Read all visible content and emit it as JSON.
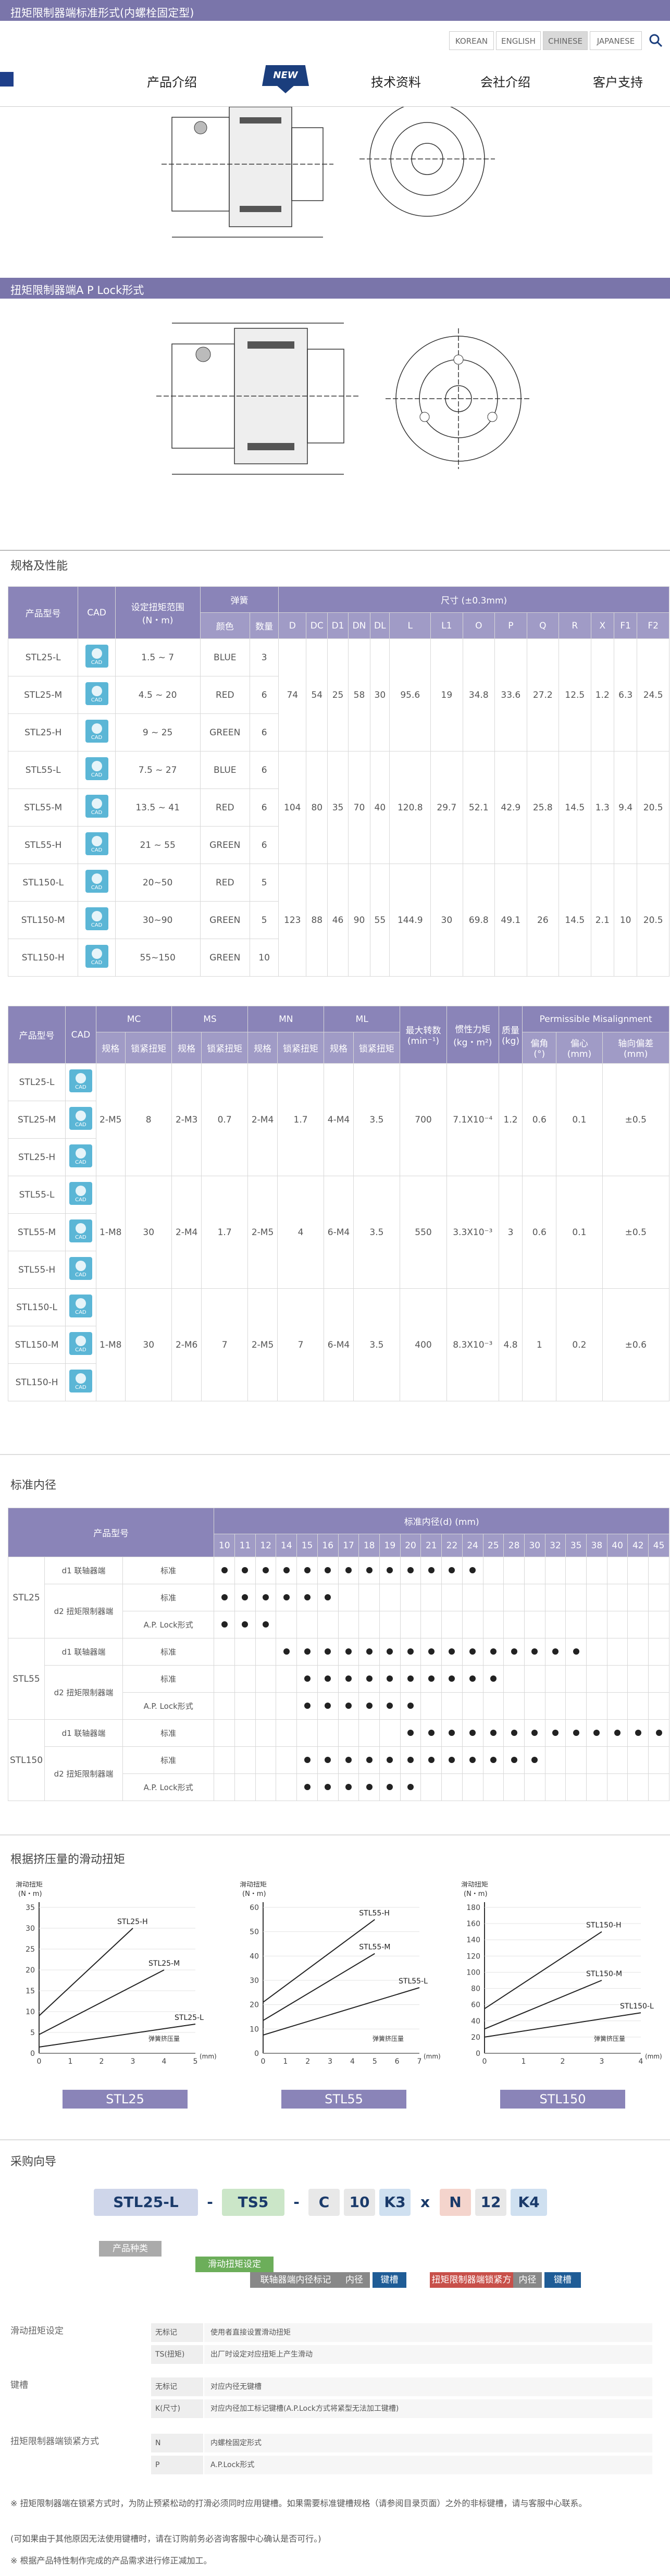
{
  "header": {
    "title": "扭矩限制器端标准形式(内螺栓固定型)",
    "languages": [
      "KOREAN",
      "ENGLISH",
      "CHINESE",
      "JAPANESE"
    ],
    "active_language": "CHINESE"
  },
  "nav": {
    "items": [
      "产品介绍",
      "技术资料",
      "会社介绍",
      "客户支持"
    ],
    "new_badge": "NEW"
  },
  "section2": {
    "title": "扭矩限制器端A P Lock形式"
  },
  "spec": {
    "title": "规格及性能",
    "t1_headers": {
      "model": "产品型号",
      "cad": "CAD",
      "torque": "设定扭矩范围",
      "torque_unit": "(N・m)",
      "spring": "弹簧",
      "color": "颜色",
      "qty": "数量",
      "dim": "尺寸 (±0.3mm)"
    },
    "t1_dim_cols": [
      "D",
      "DC",
      "D1",
      "DN",
      "DL",
      "L",
      "L1",
      "O",
      "P",
      "Q",
      "R",
      "X",
      "F1",
      "F2"
    ],
    "t1_rows": [
      {
        "model": "STL25-L",
        "torque": "1.5 ~ 7",
        "color": "BLUE",
        "qty": "3"
      },
      {
        "model": "STL25-M",
        "torque": "4.5 ~ 20",
        "color": "RED",
        "qty": "6"
      },
      {
        "model": "STL25-H",
        "torque": "9 ~ 25",
        "color": "GREEN",
        "qty": "6"
      },
      {
        "model": "STL55-L",
        "torque": "7.5 ~ 27",
        "color": "BLUE",
        "qty": "6"
      },
      {
        "model": "STL55-M",
        "torque": "13.5 ~ 41",
        "color": "RED",
        "qty": "6"
      },
      {
        "model": "STL55-H",
        "torque": "21 ~ 55",
        "color": "GREEN",
        "qty": "6"
      },
      {
        "model": "STL150-L",
        "torque": "20~50",
        "color": "RED",
        "qty": "5"
      },
      {
        "model": "STL150-M",
        "torque": "30~90",
        "color": "GREEN",
        "qty": "5"
      },
      {
        "model": "STL150-H",
        "torque": "55~150",
        "color": "GREEN",
        "qty": "10"
      }
    ],
    "t1_group_dims": [
      [
        "74",
        "54",
        "25",
        "58",
        "30",
        "95.6",
        "19",
        "34.8",
        "33.6",
        "27.2",
        "12.5",
        "1.2",
        "6.3",
        "24.5"
      ],
      [
        "104",
        "80",
        "35",
        "70",
        "40",
        "120.8",
        "29.7",
        "52.1",
        "42.9",
        "25.8",
        "14.5",
        "1.3",
        "9.4",
        "20.5"
      ],
      [
        "123",
        "88",
        "46",
        "90",
        "55",
        "144.9",
        "30",
        "69.8",
        "49.1",
        "26",
        "14.5",
        "2.1",
        "10",
        "20.5"
      ]
    ],
    "t2_headers": {
      "model": "产品型号",
      "cad": "CAD",
      "mc": "MC",
      "ms": "MS",
      "mn": "MN",
      "ml": "ML",
      "size": "规格",
      "torque": "锁紧扭矩",
      "maxrpm": "最大转数",
      "maxrpm_unit": "(min⁻¹)",
      "inertia": "惯性力矩",
      "inertia_unit": "(kg・m²)",
      "mass": "质量",
      "mass_unit": "(kg)",
      "misalign": "Permissible Misalignment",
      "angle": "偏角",
      "angle_unit": "(°)",
      "ecc": "偏心",
      "ecc_unit": "(mm)",
      "axial": "轴向偏差",
      "axial_unit": "(mm)"
    },
    "t2_groups": [
      [
        "2-M5",
        "8",
        "2-M3",
        "0.7",
        "2-M4",
        "1.7",
        "4-M4",
        "3.5",
        "700",
        "7.1X10⁻⁴",
        "1.2",
        "0.6",
        "0.1",
        "±0.5"
      ],
      [
        "1-M8",
        "30",
        "2-M4",
        "1.7",
        "2-M5",
        "4",
        "6-M4",
        "3.5",
        "550",
        "3.3X10⁻³",
        "3",
        "0.6",
        "0.1",
        "±0.5"
      ],
      [
        "1-M8",
        "30",
        "2-M6",
        "7",
        "2-M5",
        "7",
        "6-M4",
        "3.5",
        "400",
        "8.3X10⁻³",
        "4.8",
        "1",
        "0.2",
        "±0.6"
      ]
    ]
  },
  "bore": {
    "title": "标准内径",
    "headers": {
      "model": "产品型号",
      "bore": "标准内径(d) (mm)"
    },
    "sizes": [
      "10",
      "11",
      "12",
      "14",
      "15",
      "16",
      "17",
      "18",
      "19",
      "20",
      "21",
      "22",
      "24",
      "25",
      "28",
      "30",
      "32",
      "35",
      "38",
      "40",
      "42",
      "45"
    ],
    "rows": [
      {
        "group": "STL25",
        "part": "d1 联轴器端",
        "type": "标准",
        "dots": [
          1,
          1,
          1,
          1,
          1,
          1,
          1,
          1,
          1,
          1,
          1,
          1,
          1,
          0,
          0,
          0,
          0,
          0,
          0,
          0,
          0,
          0
        ]
      },
      {
        "group": "",
        "part": "d2 扭矩限制器端",
        "type": "标准",
        "dots": [
          1,
          1,
          1,
          1,
          1,
          1,
          0,
          0,
          0,
          0,
          0,
          0,
          0,
          0,
          0,
          0,
          0,
          0,
          0,
          0,
          0,
          0
        ]
      },
      {
        "group": "",
        "part": "",
        "type": "A.P. Lock形式",
        "dots": [
          1,
          1,
          1,
          0,
          0,
          0,
          0,
          0,
          0,
          0,
          0,
          0,
          0,
          0,
          0,
          0,
          0,
          0,
          0,
          0,
          0,
          0
        ]
      },
      {
        "group": "STL55",
        "part": "d1 联轴器端",
        "type": "标准",
        "dots": [
          0,
          0,
          0,
          1,
          1,
          1,
          1,
          1,
          1,
          1,
          1,
          1,
          1,
          1,
          1,
          1,
          1,
          1,
          0,
          0,
          0,
          0
        ]
      },
      {
        "group": "",
        "part": "d2 扭矩限制器端",
        "type": "标准",
        "dots": [
          0,
          0,
          0,
          0,
          1,
          1,
          1,
          1,
          1,
          1,
          1,
          1,
          1,
          1,
          0,
          0,
          0,
          0,
          0,
          0,
          0,
          0
        ]
      },
      {
        "group": "",
        "part": "",
        "type": "A.P. Lock形式",
        "dots": [
          0,
          0,
          0,
          0,
          1,
          1,
          1,
          1,
          1,
          1,
          0,
          0,
          0,
          0,
          0,
          0,
          0,
          0,
          0,
          0,
          0,
          0
        ]
      },
      {
        "group": "STL150",
        "part": "d1 联轴器端",
        "type": "标准",
        "dots": [
          0,
          0,
          0,
          0,
          0,
          0,
          0,
          0,
          0,
          1,
          1,
          1,
          1,
          1,
          1,
          1,
          1,
          1,
          1,
          1,
          1,
          1
        ]
      },
      {
        "group": "",
        "part": "d2 扭矩限制器端",
        "type": "标准",
        "dots": [
          0,
          0,
          0,
          0,
          1,
          1,
          1,
          1,
          1,
          1,
          1,
          1,
          1,
          1,
          1,
          1,
          0,
          0,
          0,
          0,
          0,
          0
        ]
      },
      {
        "group": "",
        "part": "",
        "type": "A.P. Lock形式",
        "dots": [
          0,
          0,
          0,
          0,
          1,
          1,
          1,
          1,
          1,
          1,
          0,
          0,
          0,
          0,
          0,
          0,
          0,
          0,
          0,
          0,
          0,
          0
        ]
      }
    ]
  },
  "graphs": {
    "title": "根据挤压量的滑动扭矩",
    "ylabel": "滑动扭矩",
    "yunit": "(N・m)",
    "xlabel": "弹簧挤压量",
    "xunit": "(mm)"
  },
  "chart_data": [
    {
      "type": "line",
      "title": "STL25",
      "xlabel": "弹簧挤压量 (mm)",
      "ylabel": "滑动扭矩 (N・m)",
      "xlim": [
        0,
        5
      ],
      "ylim": [
        0,
        35
      ],
      "x": [
        0,
        1,
        2,
        3,
        4,
        5
      ],
      "series": [
        {
          "name": "STL25-H",
          "values": [
            9,
            null,
            null,
            30,
            null,
            null
          ]
        },
        {
          "name": "STL25-M",
          "values": [
            4.5,
            null,
            null,
            null,
            20,
            null
          ]
        },
        {
          "name": "STL25-L",
          "values": [
            1.5,
            null,
            null,
            null,
            null,
            7
          ]
        }
      ]
    },
    {
      "type": "line",
      "title": "STL55",
      "xlabel": "弹簧挤压量 (mm)",
      "ylabel": "滑动扭矩 (N・m)",
      "xlim": [
        0,
        7
      ],
      "ylim": [
        0,
        60
      ],
      "x": [
        0,
        1,
        2,
        3,
        4,
        5,
        6,
        7
      ],
      "series": [
        {
          "name": "STL55-H",
          "values": [
            21,
            null,
            null,
            null,
            null,
            55,
            null,
            null
          ]
        },
        {
          "name": "STL55-M",
          "values": [
            13.5,
            null,
            null,
            null,
            null,
            41,
            null,
            null
          ]
        },
        {
          "name": "STL55-L",
          "values": [
            7.5,
            null,
            null,
            null,
            null,
            null,
            null,
            27
          ]
        }
      ]
    },
    {
      "type": "line",
      "title": "STL150",
      "xlabel": "弹簧挤压量 (mm)",
      "ylabel": "滑动扭矩 (N・m)",
      "xlim": [
        0,
        4
      ],
      "ylim": [
        0,
        180
      ],
      "x": [
        0,
        1,
        2,
        3,
        4
      ],
      "series": [
        {
          "name": "STL150-H",
          "values": [
            55,
            null,
            null,
            150,
            null
          ]
        },
        {
          "name": "STL150-M",
          "values": [
            30,
            null,
            null,
            90,
            null
          ]
        },
        {
          "name": "STL150-L",
          "values": [
            20,
            null,
            null,
            null,
            50
          ]
        }
      ]
    }
  ],
  "order": {
    "title": "采购向导",
    "code": [
      {
        "t": "STL25-L",
        "c": "#cfd6ea"
      },
      {
        "t": "-",
        "c": ""
      },
      {
        "t": "TS5",
        "c": "#cbe6c8"
      },
      {
        "t": "-",
        "c": ""
      },
      {
        "t": "C",
        "c": "#e8e8e8"
      },
      {
        "t": "10",
        "c": "#e8e8e8"
      },
      {
        "t": "K3",
        "c": "#cfe0f0"
      },
      {
        "t": "x",
        "c": ""
      },
      {
        "t": "N",
        "c": "#f4d4cc"
      },
      {
        "t": "12",
        "c": "#e8e8e8"
      },
      {
        "t": "K4",
        "c": "#cfe0f0"
      }
    ],
    "tags": [
      "产品种类",
      "滑动扭矩设定",
      "联轴器端内径标记",
      "内径(d1)",
      "键槽",
      "扭矩限制器端锁紧方式",
      "内径(d2)",
      "键槽"
    ],
    "groups": [
      {
        "title": "滑动扭矩设定",
        "rows": [
          [
            "无标记",
            "使用者直接设置滑动扭矩"
          ],
          [
            "TS(扭矩)",
            "出厂时设定对应扭矩上产生滑动"
          ]
        ]
      },
      {
        "title": "键槽",
        "rows": [
          [
            "无标记",
            "对应内径无键槽"
          ],
          [
            "K(尺寸)",
            "对应内径加工标记键槽(A.P.Lock方式将紧型无法加工键槽)"
          ]
        ]
      },
      {
        "title": "扭矩限制器端锁紧方式",
        "rows": [
          [
            "N",
            "内螺栓固定形式"
          ],
          [
            "P",
            "A.P.Lock形式"
          ]
        ]
      }
    ],
    "notes": [
      "※ 扭矩限制器端在锁紧方式时，为防止预紧松动的打滑必须同时应用键槽。如果需要标准键槽规格（请参阅目录页面）之外的非标键槽，请与客服中心联系。",
      "(可如果由于其他原因无法使用键槽时，请在订购前务必咨询客服中心确认是否可行。)",
      "※ 根据产品特性制作完成的产品需求进行修正减加工。"
    ]
  }
}
